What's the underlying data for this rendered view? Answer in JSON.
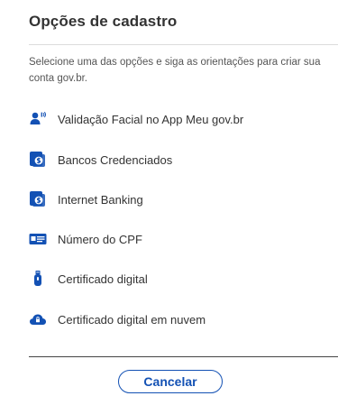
{
  "title": "Opções de cadastro",
  "description": "Selecione uma das opções e siga as orientações para criar sua conta gov.br.",
  "options": [
    {
      "label": "Validação Facial no App Meu gov.br",
      "icon": "face-recognition-icon"
    },
    {
      "label": "Bancos Credenciados",
      "icon": "bank-icon"
    },
    {
      "label": "Internet Banking",
      "icon": "internet-banking-icon"
    },
    {
      "label": "Número do CPF",
      "icon": "id-card-icon"
    },
    {
      "label": "Certificado digital",
      "icon": "usb-token-icon"
    },
    {
      "label": "Certificado digital em nuvem",
      "icon": "cloud-icon"
    }
  ],
  "cancel_label": "Cancelar",
  "colors": {
    "accent": "#1351b4",
    "text": "#333333",
    "muted": "#555555"
  }
}
